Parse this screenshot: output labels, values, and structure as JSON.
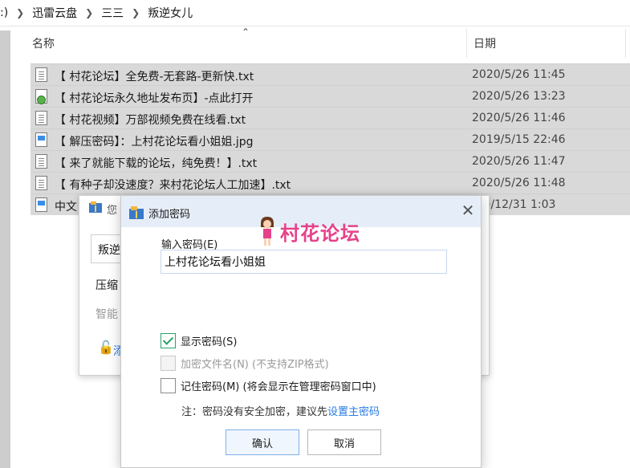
{
  "breadcrumb": {
    "drive": ":)",
    "items": [
      "迅雷云盘",
      "三三",
      "叛逆女儿"
    ]
  },
  "columns": {
    "name": "名称",
    "date": "日期"
  },
  "files": [
    {
      "name": "【 村花论坛】全免费-无套路-更新快.txt",
      "date": "2020/5/26 11:45",
      "icon": "text-file-icon"
    },
    {
      "name": "【 村花论坛永久地址发布页】-点此打开",
      "date": "2020/5/26 13:23",
      "icon": "url-shortcut-icon"
    },
    {
      "name": "【 村花视频】万部视频免费在线看.txt",
      "date": "2020/5/26 11:46",
      "icon": "text-file-icon"
    },
    {
      "name": "【 解压密码】：上村花论坛看小姐姐.jpg",
      "date": "2019/5/15 22:46",
      "icon": "image-file-icon"
    },
    {
      "name": "【 来了就能下载的论坛，纯免费！】.txt",
      "date": "2020/5/26 11:47",
      "icon": "text-file-icon"
    },
    {
      "name": "【 有种子却没速度？来村花论坛人工加速】.txt",
      "date": "2020/5/26 11:48",
      "icon": "text-file-icon"
    },
    {
      "name": "中文",
      "date": ")/12/31 1:03",
      "icon": "image-file-icon"
    }
  ],
  "bg_dialog": {
    "title": "您",
    "input_value": "叛逆",
    "label_compress": "压缩",
    "label_smart": "智能",
    "link_text": "添"
  },
  "modal": {
    "title": "添加密码",
    "logo_text": "村花论坛",
    "password_label": "输入密码(E)",
    "password_value": "上村花论坛看小姐姐",
    "show_password": "显示密码(S)",
    "encrypt_filenames": "加密文件名(N) (不支持ZIP格式)",
    "remember_password": "记住密码(M) (将会显示在管理密码窗口中)",
    "note_prefix": "注：密码没有安全加密，建议先",
    "note_link": "设置主密码",
    "ok_label": "确认",
    "cancel_label": "取消"
  },
  "colors": {
    "selected_row": "#d9d9d9",
    "modal_header": "#e5eef8",
    "link": "#2a7be4",
    "logo": "#e6428a",
    "check": "#2aa16e"
  }
}
